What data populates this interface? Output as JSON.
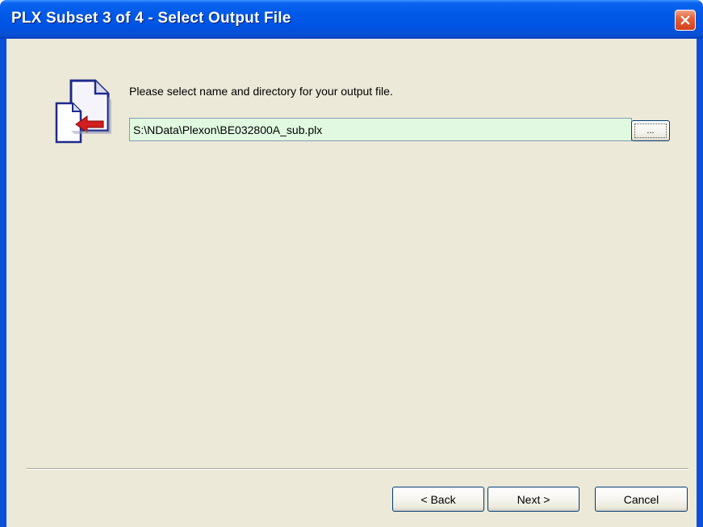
{
  "window": {
    "title": "PLX Subset 3 of 4 - Select Output File"
  },
  "main": {
    "prompt": "Please select name and directory for your output file.",
    "output_path": "S:\\NData\\Plexon\\BE032800A_sub.plx",
    "browse_label": "...",
    "icon": "document-arrow-icon"
  },
  "buttons": {
    "back": "< Back",
    "next": "Next >",
    "cancel": "Cancel"
  },
  "colors": {
    "titlebar": "#0054e3",
    "client_bg": "#ece9d8",
    "input_bg": "#e1f9e1",
    "close_button": "#d4401c"
  }
}
